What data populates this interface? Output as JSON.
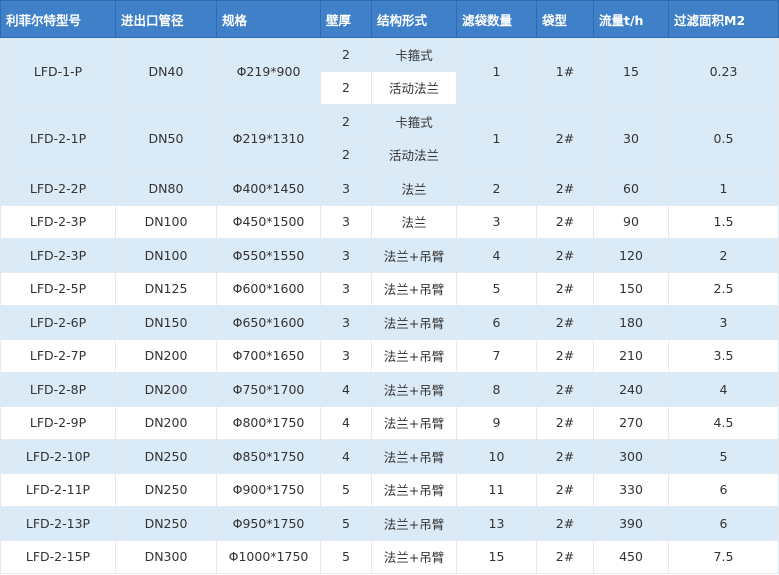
{
  "headers": [
    "利菲尔特型号",
    "进出口管径",
    "规格",
    "壁厚",
    "结构形式",
    "滤袋数量",
    "袋型",
    "流量t/h",
    "过滤面积M2"
  ],
  "rows": [
    {
      "model": "LFD-1-P",
      "port": "DN40",
      "spec": "Φ219*900",
      "wall": "2",
      "structure": "卡箍式",
      "bags": "1",
      "bag_type": "1#",
      "flow": "15",
      "area": "0.23",
      "sub": {
        "wall": "2",
        "structure": "活动法兰"
      }
    },
    {
      "model": "LFD-2-1P",
      "port": "DN50",
      "spec": "Φ219*1310",
      "wall": "2",
      "structure": "卡箍式",
      "bags": "1",
      "bag_type": "2#",
      "flow": "30",
      "area": "0.5",
      "sub": {
        "wall": "2",
        "structure": "活动法兰"
      }
    },
    {
      "model": "LFD-2-2P",
      "port": "DN80",
      "spec": "Φ400*1450",
      "wall": "3",
      "structure": "法兰",
      "bags": "2",
      "bag_type": "2#",
      "flow": "60",
      "area": "1"
    },
    {
      "model": "LFD-2-3P",
      "port": "DN100",
      "spec": "Φ450*1500",
      "wall": "3",
      "structure": "法兰",
      "bags": "3",
      "bag_type": "2#",
      "flow": "90",
      "area": "1.5"
    },
    {
      "model": "LFD-2-3P",
      "port": "DN100",
      "spec": "Φ550*1550",
      "wall": "3",
      "structure": "法兰+吊臂",
      "bags": "4",
      "bag_type": "2#",
      "flow": "120",
      "area": "2"
    },
    {
      "model": "LFD-2-5P",
      "port": "DN125",
      "spec": "Φ600*1600",
      "wall": "3",
      "structure": "法兰+吊臂",
      "bags": "5",
      "bag_type": "2#",
      "flow": "150",
      "area": "2.5"
    },
    {
      "model": "LFD-2-6P",
      "port": "DN150",
      "spec": "Φ650*1600",
      "wall": "3",
      "structure": "法兰+吊臂",
      "bags": "6",
      "bag_type": "2#",
      "flow": "180",
      "area": "3"
    },
    {
      "model": "LFD-2-7P",
      "port": "DN200",
      "spec": "Φ700*1650",
      "wall": "3",
      "structure": "法兰+吊臂",
      "bags": "7",
      "bag_type": "2#",
      "flow": "210",
      "area": "3.5"
    },
    {
      "model": "LFD-2-8P",
      "port": "DN200",
      "spec": "Φ750*1700",
      "wall": "4",
      "structure": "法兰+吊臂",
      "bags": "8",
      "bag_type": "2#",
      "flow": "240",
      "area": "4"
    },
    {
      "model": "LFD-2-9P",
      "port": "DN200",
      "spec": "Φ800*1750",
      "wall": "4",
      "structure": "法兰+吊臂",
      "bags": "9",
      "bag_type": "2#",
      "flow": "270",
      "area": "4.5"
    },
    {
      "model": "LFD-2-10P",
      "port": "DN250",
      "spec": "Φ850*1750",
      "wall": "4",
      "structure": "法兰+吊臂",
      "bags": "10",
      "bag_type": "2#",
      "flow": "300",
      "area": "5"
    },
    {
      "model": "LFD-2-11P",
      "port": "DN250",
      "spec": "Φ900*1750",
      "wall": "5",
      "structure": "法兰+吊臂",
      "bags": "11",
      "bag_type": "2#",
      "flow": "330",
      "area": "6"
    },
    {
      "model": "LFD-2-13P",
      "port": "DN250",
      "spec": "Φ950*1750",
      "wall": "5",
      "structure": "法兰+吊臂",
      "bags": "13",
      "bag_type": "2#",
      "flow": "390",
      "area": "6"
    },
    {
      "model": "LFD-2-15P",
      "port": "DN300",
      "spec": "Φ1000*1750",
      "wall": "5",
      "structure": "法兰+吊臂",
      "bags": "15",
      "bag_type": "2#",
      "flow": "450",
      "area": "7.5"
    }
  ],
  "colors": {
    "header_bg": "#3f80c8",
    "header_text": "#ffffff",
    "row_alt_bg": "#dbeaf7",
    "text": "#333333"
  }
}
